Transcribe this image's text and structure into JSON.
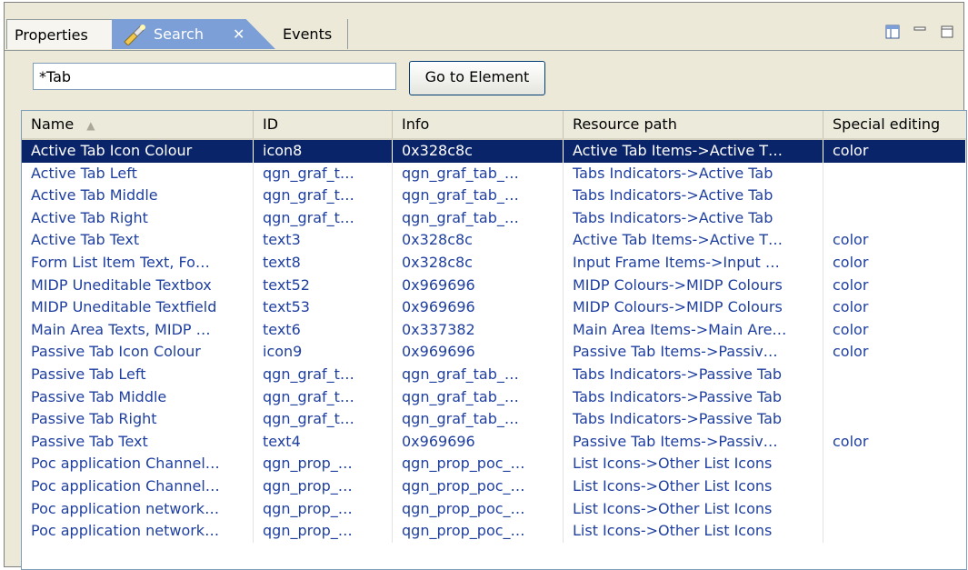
{
  "tabs": {
    "properties": "Properties",
    "search": "Search",
    "search_close": "✕",
    "events": "Events"
  },
  "search": {
    "value": "*Tab",
    "go_button": "Go to Element"
  },
  "table": {
    "columns": [
      "Name",
      "ID",
      "Info",
      "Resource path",
      "Special editing"
    ],
    "sort_indicator": "▲",
    "rows": [
      {
        "name": "Active Tab Icon Colour",
        "id": "icon8",
        "info": "0x328c8c",
        "path": "Active Tab Items->Active T…",
        "special": "color",
        "selected": true
      },
      {
        "name": "Active Tab Left",
        "id": "qgn_graf_t…",
        "info": "qgn_graf_tab_…",
        "path": "Tabs Indicators->Active Tab",
        "special": ""
      },
      {
        "name": "Active Tab Middle",
        "id": "qgn_graf_t…",
        "info": "qgn_graf_tab_…",
        "path": "Tabs Indicators->Active Tab",
        "special": ""
      },
      {
        "name": "Active Tab Right",
        "id": "qgn_graf_t…",
        "info": "qgn_graf_tab_…",
        "path": "Tabs Indicators->Active Tab",
        "special": ""
      },
      {
        "name": "Active Tab Text",
        "id": "text3",
        "info": "0x328c8c",
        "path": "Active Tab Items->Active T…",
        "special": "color"
      },
      {
        "name": "Form List Item Text, Fo…",
        "id": "text8",
        "info": "0x328c8c",
        "path": "Input Frame Items->Input …",
        "special": "color"
      },
      {
        "name": "MIDP Uneditable Textbox",
        "id": "text52",
        "info": "0x969696",
        "path": "MIDP Colours->MIDP Colours",
        "special": "color"
      },
      {
        "name": "MIDP Uneditable Textfield",
        "id": "text53",
        "info": "0x969696",
        "path": "MIDP Colours->MIDP Colours",
        "special": "color"
      },
      {
        "name": "Main Area Texts, MIDP …",
        "id": "text6",
        "info": "0x337382",
        "path": "Main Area Items->Main Are…",
        "special": "color"
      },
      {
        "name": "Passive Tab Icon Colour",
        "id": "icon9",
        "info": "0x969696",
        "path": "Passive Tab Items->Passiv…",
        "special": "color"
      },
      {
        "name": "Passive Tab Left",
        "id": "qgn_graf_t…",
        "info": "qgn_graf_tab_…",
        "path": "Tabs Indicators->Passive Tab",
        "special": ""
      },
      {
        "name": "Passive Tab Middle",
        "id": "qgn_graf_t…",
        "info": "qgn_graf_tab_…",
        "path": "Tabs Indicators->Passive Tab",
        "special": ""
      },
      {
        "name": "Passive Tab Right",
        "id": "qgn_graf_t…",
        "info": "qgn_graf_tab_…",
        "path": "Tabs Indicators->Passive Tab",
        "special": ""
      },
      {
        "name": "Passive Tab Text",
        "id": "text4",
        "info": "0x969696",
        "path": "Passive Tab Items->Passiv…",
        "special": "color"
      },
      {
        "name": "Poc application Channel…",
        "id": "qgn_prop_…",
        "info": "qgn_prop_poc_…",
        "path": "List Icons->Other List Icons",
        "special": ""
      },
      {
        "name": "Poc application Channel…",
        "id": "qgn_prop_…",
        "info": "qgn_prop_poc_…",
        "path": "List Icons->Other List Icons",
        "special": ""
      },
      {
        "name": "Poc application network…",
        "id": "qgn_prop_…",
        "info": "qgn_prop_poc_…",
        "path": "List Icons->Other List Icons",
        "special": ""
      },
      {
        "name": "Poc application network…",
        "id": "qgn_prop_…",
        "info": "qgn_prop_poc_…",
        "path": "List Icons->Other List Icons",
        "special": ""
      }
    ]
  },
  "icons": {
    "search_tab": "flashlight-search-icon",
    "view_toolbar": "view-layout-icon",
    "minimize": "minimize-icon",
    "maximize": "maximize-icon"
  },
  "colors": {
    "selection_bg": "#0a246a",
    "link_text": "#1f3f9f",
    "active_tab": "#7b9fd6"
  }
}
